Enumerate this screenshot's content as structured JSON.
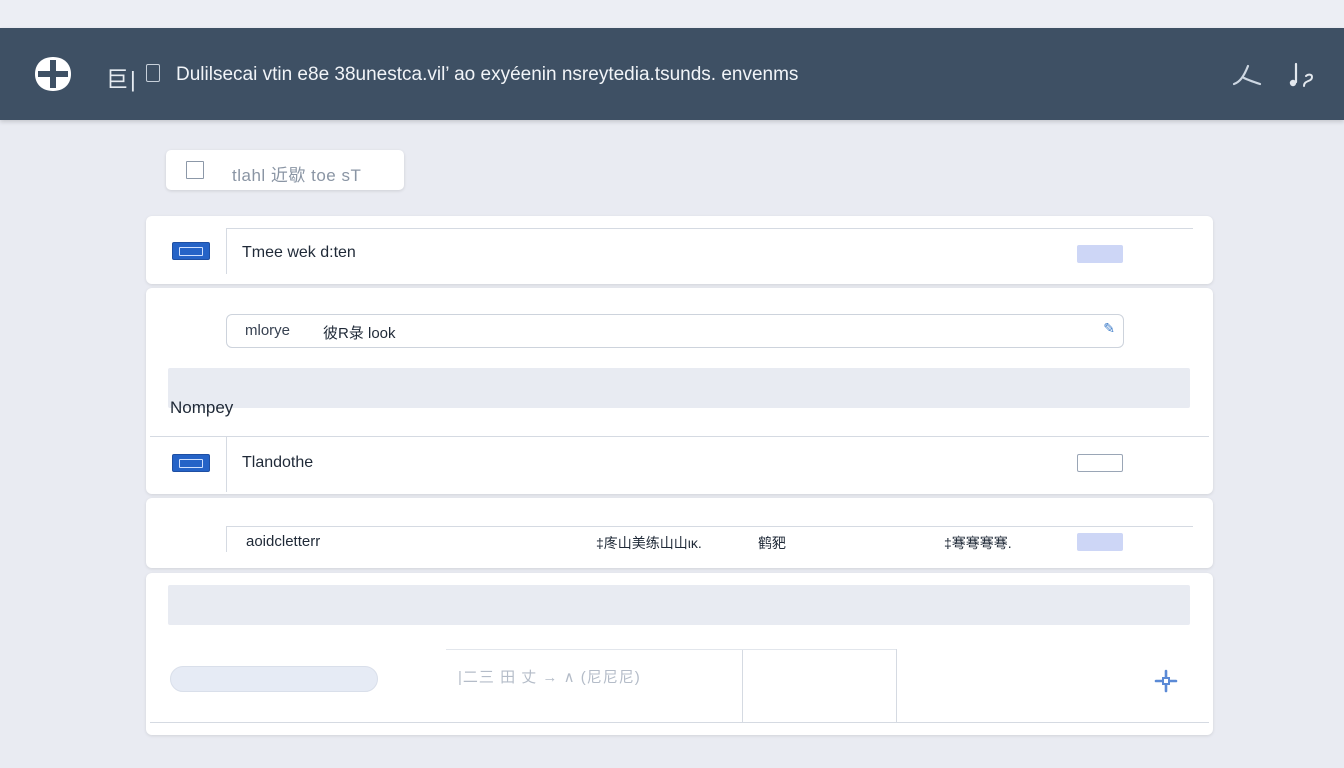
{
  "header": {
    "title": "Dulilsecai vtin e8e 38unestca.vil’ ao exyéenin nsreytedia.tsunds. envenms",
    "menu_glyph": "巨|",
    "icons": [
      "logo-icon",
      "menu-icon",
      "document-icon",
      "wave-icon",
      "music-note-icon"
    ]
  },
  "chip": {
    "label": "tlahl 近歇 toe sT"
  },
  "rows": {
    "row1_label": "Tmee wek d:ten",
    "input1_placeholder": "mlorye",
    "input1_value": "彼R彔 look",
    "section_label": "Nompey",
    "row2_label": "Tlandothe",
    "row3_label": "aoidcletterr",
    "row3_col2": "‡庝山美练山山ικ.",
    "row3_col3": "鹤豝",
    "row3_col4": "‡弿弿弿弿."
  },
  "footer": {
    "filter_text": "|二三 田 丈 → ∧ (尼尼尼)"
  },
  "colors": {
    "header_bg": "#3e5064",
    "accent_blue": "#2563c7",
    "page_bg": "#e9ebf2"
  }
}
